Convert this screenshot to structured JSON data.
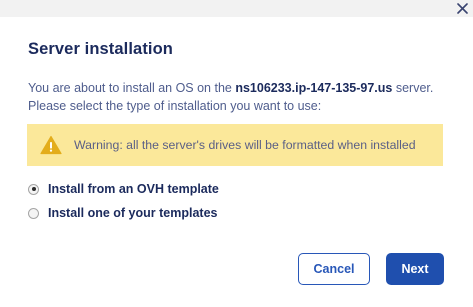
{
  "dialog": {
    "title": "Server installation",
    "description": {
      "part1": "You are about to install an OS on the ",
      "hostname": "ns106233.ip-147-135-97.us",
      "part2": " server.",
      "line2": "Please select the type of installation you want to use:"
    },
    "warning": {
      "icon": "warning-triangle-icon",
      "text": "Warning: all the server's drives will be formatted when installed",
      "color": "#fbe89a"
    },
    "options": [
      {
        "label": "Install from an OVH template",
        "selected": true
      },
      {
        "label": "Install one of your templates",
        "selected": false
      }
    ],
    "buttons": {
      "cancel": "Cancel",
      "next": "Next"
    },
    "close_icon": "close-icon",
    "colors": {
      "primary": "#1f4fae",
      "title": "#1b2a5c",
      "text": "#4f5d8d"
    }
  }
}
